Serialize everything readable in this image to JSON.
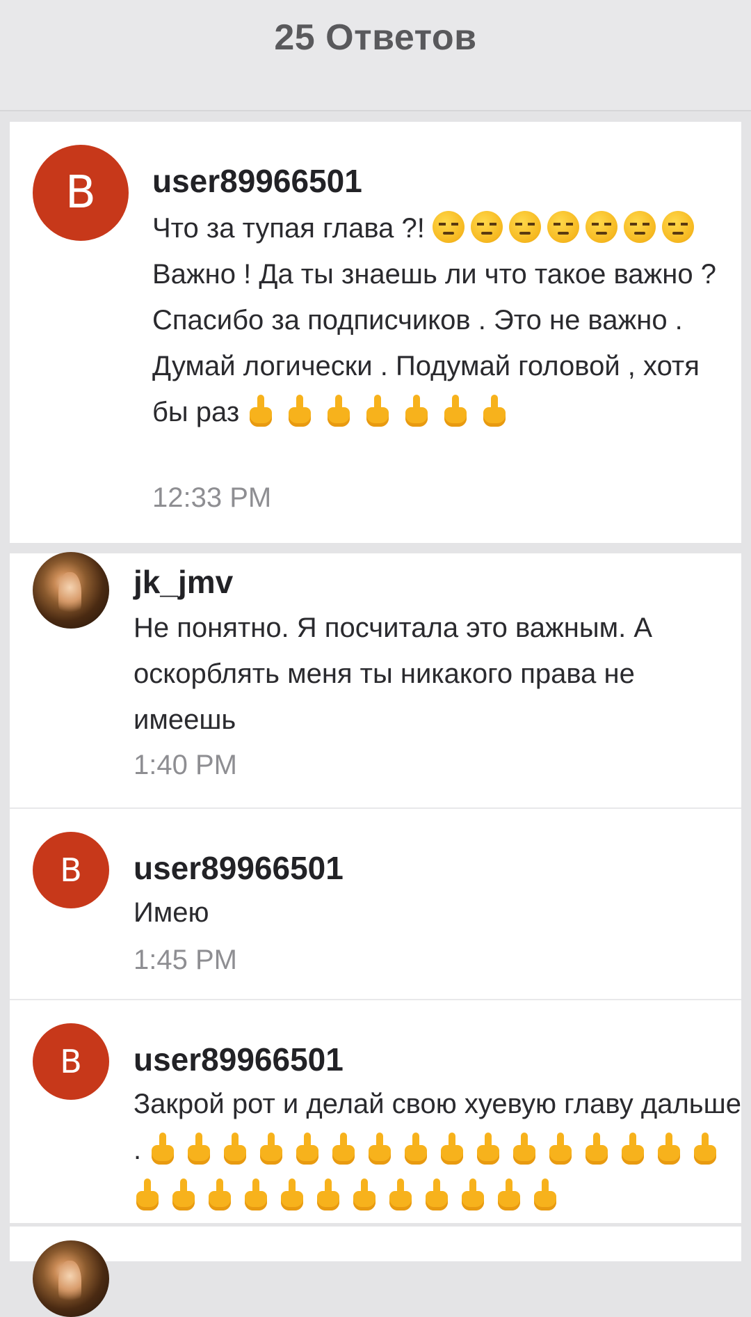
{
  "header": {
    "title": "25 Ответов"
  },
  "comments": [
    {
      "avatar_letter": "B",
      "username": "user89966501",
      "text_parts": [
        "Что за тупая глава ?! ",
        "Важно ! Да ты знаешь ли что такое важно ? Спасибо за подписчиков . Это не важно . Думай логически . Подумай головой , хотя бы раз "
      ],
      "emoji_unamused_count": 7,
      "emoji_finger_count": 7,
      "time": "12:33 PM"
    },
    {
      "avatar_type": "photo",
      "username": "jk_jmv",
      "text": "Не понятно. Я посчитала это важным. А оскорблять меня ты никакого права не имеешь",
      "time": "1:40 PM"
    },
    {
      "avatar_letter": "B",
      "username": "user89966501",
      "text": "Имею",
      "time": "1:45 PM"
    },
    {
      "avatar_letter": "B",
      "username": "user89966501",
      "text": "Закрой рот и делай свою хуевую главу дальше . ",
      "emoji_finger_count": 28
    }
  ],
  "colors": {
    "avatar_bg": "#c7381a",
    "emoji_yellow": "#f7b21c",
    "header_bg": "#e8e8ea",
    "time_gray": "#8e8e92"
  },
  "icons": [
    "unamused-face-icon",
    "middle-finger-icon",
    "send-arrow-icon"
  ]
}
